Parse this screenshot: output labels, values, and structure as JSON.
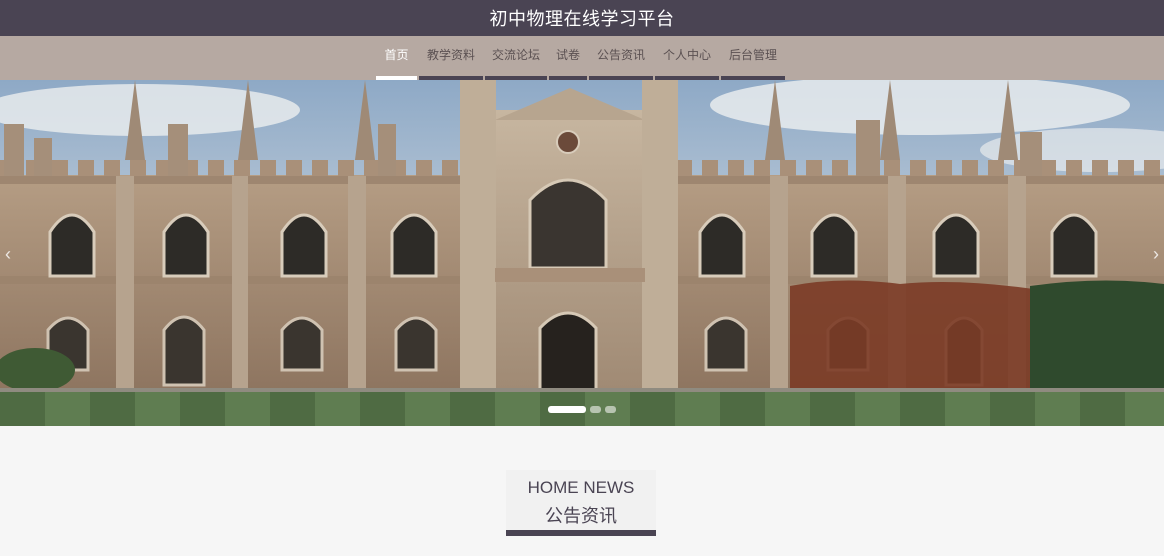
{
  "header": {
    "title": "初中物理在线学习平台"
  },
  "nav": {
    "items": [
      {
        "label": "首页",
        "active": true
      },
      {
        "label": "教学资料"
      },
      {
        "label": "交流论坛"
      },
      {
        "label": "试卷"
      },
      {
        "label": "公告资讯"
      },
      {
        "label": "个人中心"
      },
      {
        "label": "后台管理"
      }
    ]
  },
  "carousel": {
    "slide_count": 3,
    "active_index": 0,
    "prev_icon": "chevron-left-icon",
    "next_icon": "chevron-right-icon",
    "image_subject": "gothic-college-building"
  },
  "news_section": {
    "title_en": "HOME NEWS",
    "title_cn": "公告资讯"
  },
  "colors": {
    "header_bg": "#4a4453",
    "nav_bg": "#b6a9a2",
    "nav_text": "#5b5152",
    "active": "#ffffff",
    "page_bg": "#f6f6f6"
  }
}
